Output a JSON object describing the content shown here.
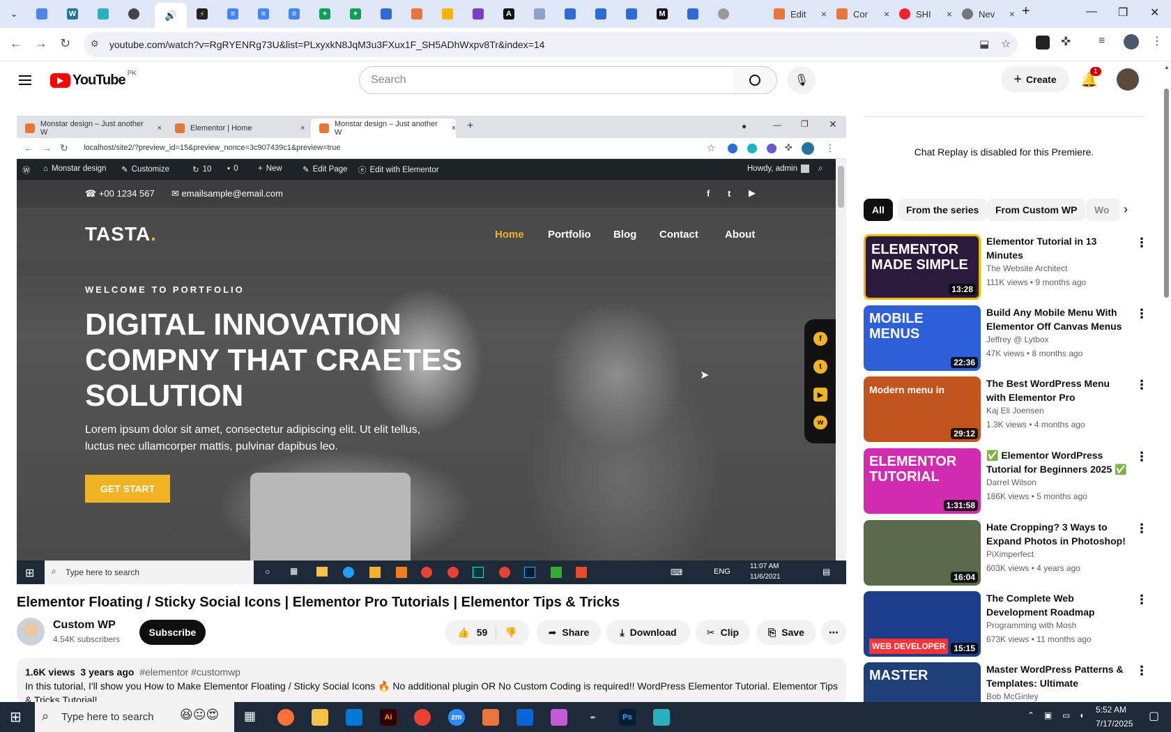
{
  "browser": {
    "tabs": [
      {
        "icon": "chevron-down-icon"
      },
      {
        "icon": "tab-favicon"
      },
      {
        "icon": "tab-favicon"
      },
      {
        "icon": "tab-favicon"
      },
      {
        "icon": "tab-favicon"
      },
      {
        "icon": "tab-favicon"
      }
    ],
    "wide_tabs": [
      {
        "label": "Edit",
        "close": "×"
      },
      {
        "label": "Cor",
        "close": "×"
      },
      {
        "label": "SHI",
        "close": "×"
      },
      {
        "label": "Nev",
        "close": "×"
      }
    ],
    "new_tab": "+",
    "window_controls": {
      "minimize": "—",
      "restore": "❐",
      "close": "✕"
    },
    "url": "youtube.com/watch?v=RgRYENRg73U&list=PLxyxkN8JqM3u3FXux1F_SH5ADhWxpv8Tr&index=14"
  },
  "youtube": {
    "logo_text": "YouTube",
    "country": "PK",
    "search_placeholder": "Search",
    "create_label": "Create",
    "notification_count": "1"
  },
  "player": {
    "inner_tabs": [
      {
        "label": "Monstar design – Just another W",
        "close": "×"
      },
      {
        "label": "Elementor | Home",
        "close": "×"
      },
      {
        "label": "Monstar design – Just another W",
        "close": "×"
      }
    ],
    "inner_url": "localhost/site2/?preview_id=15&preview_nonce=3c907439c1&preview=true",
    "wp_bar": {
      "site": "Monstar design",
      "customize": "Customize",
      "updates": "10",
      "comments": "0",
      "new": "New",
      "edit_page": "Edit Page",
      "edit_elementor": "Edit with Elementor",
      "howdy": "Howdy, admin"
    },
    "site": {
      "phone": "+00 1234 567",
      "email": "emailsample@email.com",
      "logo": "TASTA",
      "logo_dot": ".",
      "nav": [
        "Home",
        "Portfolio",
        "Blog",
        "Contact",
        "About"
      ],
      "welcome": "WELCOME TO PORTFOLIO",
      "headline_1": "DIGITAL INNOVATION",
      "headline_2": "COMPNY THAT CRAETES",
      "headline_3": "SOLUTION",
      "lorem_1": "Lorem ipsum dolor sit amet, consectetur adipiscing elit. Ut elit tellus,",
      "lorem_2": "luctus nec ullamcorper mattis, pulvinar dapibus leo.",
      "cta": "GET START",
      "social": [
        "f",
        "t",
        "▶",
        "w"
      ]
    },
    "inner_taskbar": {
      "search": "Type here to search",
      "lang": "ENG",
      "time": "11:07 AM",
      "date": "11/6/2021"
    }
  },
  "video": {
    "title": "Elementor Floating / Sticky Social Icons | Elementor Pro Tutorials | Elementor Tips & Tricks",
    "channel": "Custom WP",
    "subscribers": "4.54K subscribers",
    "subscribe": "Subscribe",
    "likes": "59",
    "share": "Share",
    "download": "Download",
    "clip": "Clip",
    "save": "Save",
    "views": "1.6K views",
    "age": "3 years ago",
    "tags": "#elementor #customwp",
    "description_1": "In this tutorial, I'll show you How to Make Elementor Floating / Sticky Social Icons 🔥 No additional plugin OR No Custom Coding is required!! WordPress Elementor Tutorial. Elementor Tips",
    "description_2": "& Tricks Tutorial!"
  },
  "sidebar": {
    "chat_message": "Chat Replay is disabled for this Premiere.",
    "chips": [
      "All",
      "From the series",
      "From Custom WP",
      "Wo"
    ],
    "recommendations": [
      {
        "title": "Elementor Tutorial in 13 Minutes",
        "channel": "The Website Architect",
        "meta": "111K views • 9 months ago",
        "duration": "13:28",
        "thumb_text": "ELEMENTOR MADE SIMPLE",
        "thumb_bg": "#2a1b3d"
      },
      {
        "title": "Build Any Mobile Menu With Elementor Off Canvas Menus ...",
        "channel": "Jeffrey @ Lytbox",
        "meta": "47K views • 8 months ago",
        "duration": "22:36",
        "thumb_text": "MOBILE MENUS",
        "thumb_bg": "#2d5fd8"
      },
      {
        "title": "The Best WordPress Menu with Elementor Pro",
        "channel": "Kaj Eli Joensen",
        "meta": "1.3K views • 4 months ago",
        "duration": "29:12",
        "thumb_text": "Modern menu in",
        "thumb_bg": "#c2541d"
      },
      {
        "title": "✅ Elementor WordPress Tutorial for Beginners 2025 ✅",
        "channel": "Darrel Wilson",
        "meta": "186K views • 5 months ago",
        "duration": "1:31:58",
        "thumb_text": "ELEMENTOR TUTORIAL",
        "thumb_bg": "#d12bb0"
      },
      {
        "title": "Hate Cropping? 3 Ways to Expand Photos in Photoshop!",
        "channel": "PiXimperfect",
        "meta": "603K views • 4 years ago",
        "duration": "16:04",
        "thumb_text": "",
        "thumb_bg": "#5a6a4a"
      },
      {
        "title": "The Complete Web Development Roadmap",
        "channel": "Programming with Mosh",
        "meta": "673K views • 11 months ago",
        "duration": "15:15",
        "thumb_text": "WEB DEVELOPER",
        "thumb_bg": "#1b3d8c"
      },
      {
        "title": "Master WordPress Patterns & Templates: Ultimate Beginner'...",
        "channel": "Bob McGinley",
        "meta": "",
        "duration": "",
        "thumb_text": "MASTER",
        "thumb_bg": "#1f3f7a"
      }
    ]
  },
  "taskbar": {
    "search": "Type here to search",
    "time": "5:52 AM",
    "date": "7/17/2025"
  }
}
